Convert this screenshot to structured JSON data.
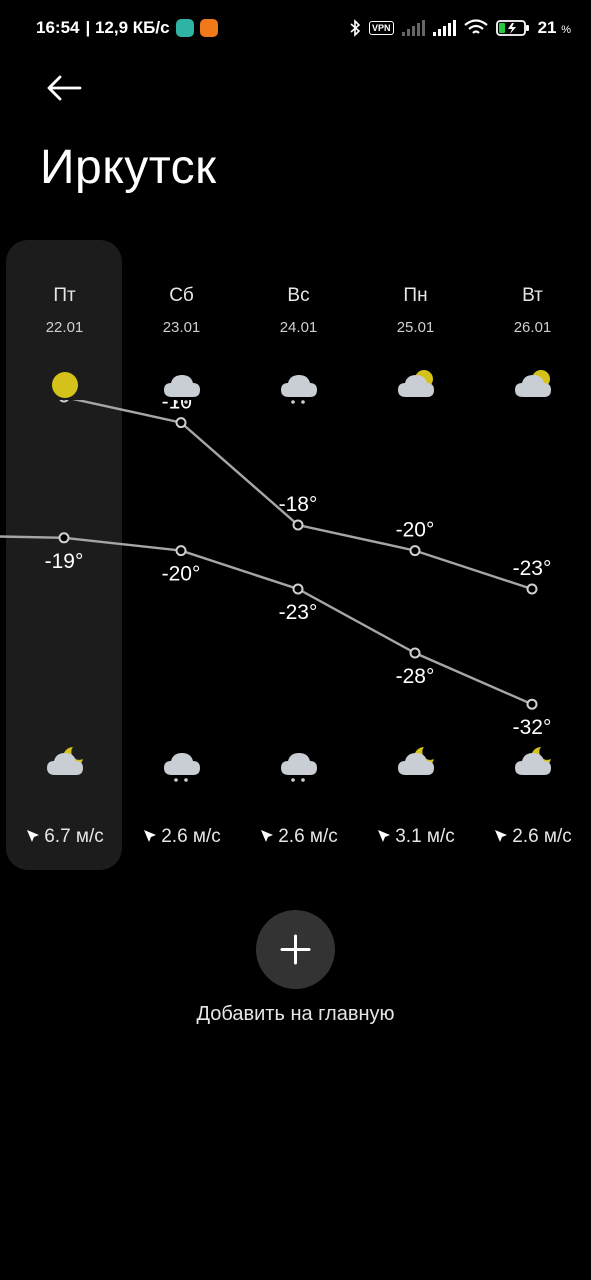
{
  "status_bar": {
    "time": "16:54",
    "net_speed": "| 12,9 КБ/с",
    "vpn_label": "VPN",
    "battery_percent": "21",
    "battery_unit": "%"
  },
  "header": {
    "city": "Иркутск"
  },
  "days": [
    {
      "name": "Пт",
      "date": "22.01",
      "icon_top": "sun-icon",
      "icon_bottom": "cloud-moon-icon",
      "wind": "6.7 м/с",
      "selected": true
    },
    {
      "name": "Сб",
      "date": "23.01",
      "icon_top": "snow-cloud-icon",
      "icon_bottom": "snow-cloud-icon",
      "wind": "2.6 м/с",
      "selected": false
    },
    {
      "name": "Вс",
      "date": "24.01",
      "icon_top": "snow-cloud-icon",
      "icon_bottom": "snow-cloud-icon",
      "wind": "2.6 м/с",
      "selected": false
    },
    {
      "name": "Пн",
      "date": "25.01",
      "icon_top": "cloud-sun-icon",
      "icon_bottom": "cloud-moon-icon",
      "wind": "3.1 м/с",
      "selected": false
    },
    {
      "name": "Вт",
      "date": "26.01",
      "icon_top": "cloud-sun-icon",
      "icon_bottom": "cloud-moon-icon",
      "wind": "2.6 м/с",
      "selected": false
    }
  ],
  "chart_data": {
    "type": "line",
    "categories": [
      "22.01",
      "23.01",
      "24.01",
      "25.01",
      "26.01"
    ],
    "series": [
      {
        "values": [
          -8,
          -10,
          -18,
          -20,
          -23
        ],
        "labels": [
          "-8°",
          "-10°",
          "-18°",
          "-20°",
          "-23°"
        ]
      },
      {
        "values": [
          -19,
          -20,
          -23,
          -28,
          -32
        ],
        "labels": [
          "-19°",
          "-20°",
          "-23°",
          "-28°",
          "-32°"
        ]
      }
    ]
  },
  "actions": {
    "add_home_label": "Добавить на главную"
  },
  "colors": {
    "accent_yellow": "#d4c21b",
    "cloud_gray": "#c9cdd4",
    "selected_bg": "#1c1c1c"
  }
}
